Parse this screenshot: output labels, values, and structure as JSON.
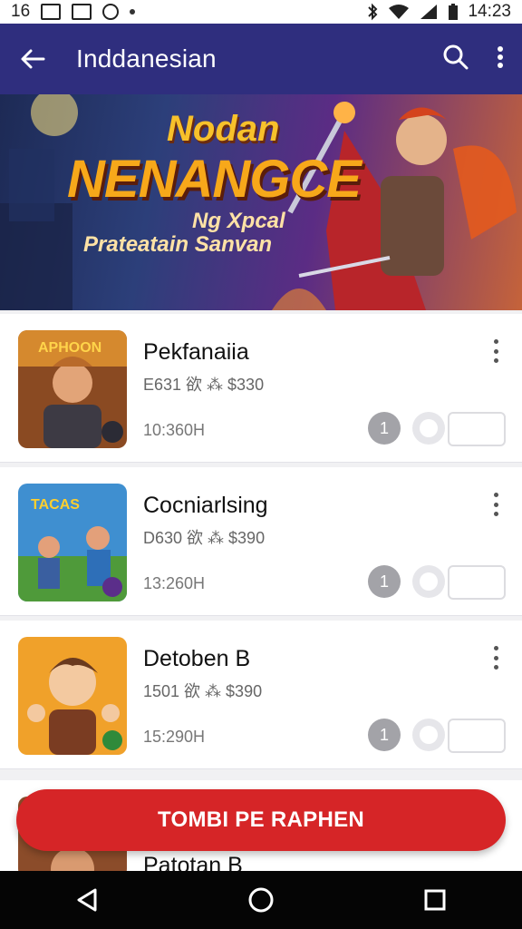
{
  "status_bar": {
    "time_left": "16",
    "time_right": "14:23"
  },
  "app_bar": {
    "title": "Inddanesian",
    "back_icon": "arrow-back-icon",
    "search_icon": "search-icon",
    "menu_icon": "more-vert-icon"
  },
  "hero": {
    "line1": "Nodan",
    "line2": "NENANGCE",
    "line3": "Ng Xpcal",
    "line4": "Prateatain Sanvan"
  },
  "items": [
    {
      "name": "Pekfanaiia",
      "meta": "E631 欲 ⁂ $330",
      "size": "10:360H",
      "badge": "1"
    },
    {
      "name": "Cocniarlsing",
      "meta": "D630 欲 ⁂ $390",
      "size": "13:260H",
      "badge": "1"
    },
    {
      "name": "Detoben B",
      "meta": "1501 欲 ⁂ $390",
      "size": "15:290H",
      "badge": "1"
    }
  ],
  "peek_item": {
    "name": "Patotan B"
  },
  "cta": {
    "label": "TOMBI PE RAPHEN"
  },
  "colors": {
    "app_bar": "#2f2e7e",
    "cta": "#d62527",
    "nav_bar": "#050505"
  }
}
